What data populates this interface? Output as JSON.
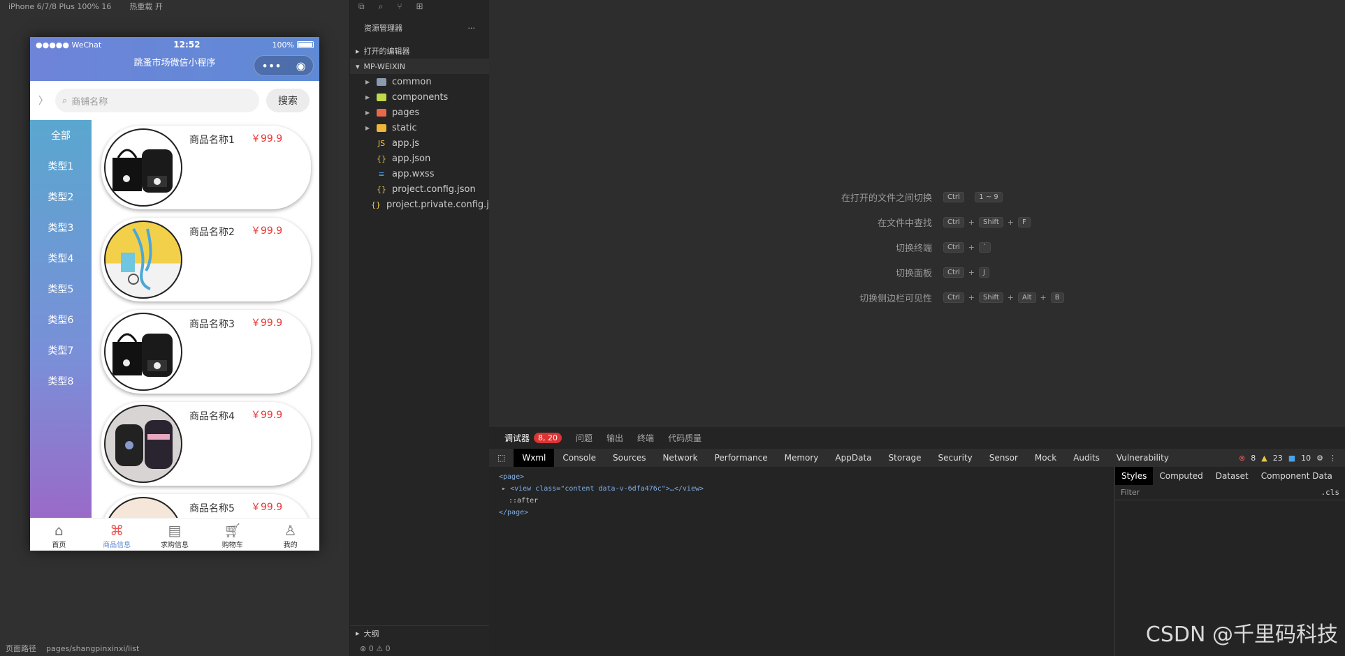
{
  "simulator": {
    "device": "iPhone 6/7/8 Plus 100% 16",
    "hot_reload": "热重载 开",
    "statusbar": {
      "carrier": "●●●●● WeChat",
      "time": "12:52",
      "battery": "100%"
    },
    "title": "跳蚤市场微信小程序",
    "search": {
      "placeholder": "商铺名称",
      "button": "搜索"
    },
    "categories": [
      "全部",
      "类型1",
      "类型2",
      "类型3",
      "类型4",
      "类型5",
      "类型6",
      "类型7",
      "类型8"
    ],
    "goods": [
      {
        "name": "商品名称1",
        "price": "￥99.9"
      },
      {
        "name": "商品名称2",
        "price": "￥99.9"
      },
      {
        "name": "商品名称3",
        "price": "￥99.9"
      },
      {
        "name": "商品名称4",
        "price": "￥99.9"
      },
      {
        "name": "商品名称5",
        "price": "￥99.9"
      }
    ],
    "tabbar": [
      {
        "label": "首页",
        "icon": "home-icon"
      },
      {
        "label": "商品信息",
        "icon": "clover-icon"
      },
      {
        "label": "求购信息",
        "icon": "calendar-icon"
      },
      {
        "label": "购物车",
        "icon": "cart-icon"
      },
      {
        "label": "我的",
        "icon": "user-icon"
      }
    ],
    "bottom": {
      "path_label": "页面路径",
      "path": "pages/shangpinxinxi/list"
    }
  },
  "explorer": {
    "title": "资源管理器",
    "open_editors": "打开的编辑器",
    "project": "MP-WEIXIN",
    "folders": [
      "common",
      "components",
      "pages",
      "static"
    ],
    "files": [
      "app.js",
      "app.json",
      "app.wxss",
      "project.config.json",
      "project.private.config.js..."
    ],
    "outline": "大纲",
    "status": "⊗ 0 ⚠ 0"
  },
  "editor": {
    "tips": [
      {
        "label": "在打开的文件之间切换",
        "keys": [
          "Ctrl",
          "1 ~ 9"
        ]
      },
      {
        "label": "在文件中查找",
        "keys": [
          "Ctrl",
          "Shift",
          "F"
        ]
      },
      {
        "label": "切换终端",
        "keys": [
          "Ctrl",
          "`"
        ]
      },
      {
        "label": "切换面板",
        "keys": [
          "Ctrl",
          "J"
        ]
      },
      {
        "label": "切换侧边栏可见性",
        "keys": [
          "Ctrl",
          "Shift",
          "Alt",
          "B"
        ]
      }
    ]
  },
  "devtools": {
    "tabs_top": [
      "调试器",
      "问题",
      "输出",
      "终端",
      "代码质量"
    ],
    "badge": "8, 20",
    "tabs": [
      "Wxml",
      "Console",
      "Sources",
      "Network",
      "Performance",
      "Memory",
      "AppData",
      "Storage",
      "Security",
      "Sensor",
      "Mock",
      "Audits",
      "Vulnerability"
    ],
    "counts": {
      "errors": "8",
      "warnings": "23",
      "info": "10"
    },
    "wxml": {
      "page_open": "<page>",
      "view": "<view class=\"content data-v-6dfa476c\">…</view>",
      "after": "::after",
      "page_close": "</page>"
    },
    "side_tabs": [
      "Styles",
      "Computed",
      "Dataset",
      "Component Data"
    ],
    "filter_placeholder": "Filter",
    "cls": ".cls"
  },
  "watermark": "CSDN @千里码科技"
}
